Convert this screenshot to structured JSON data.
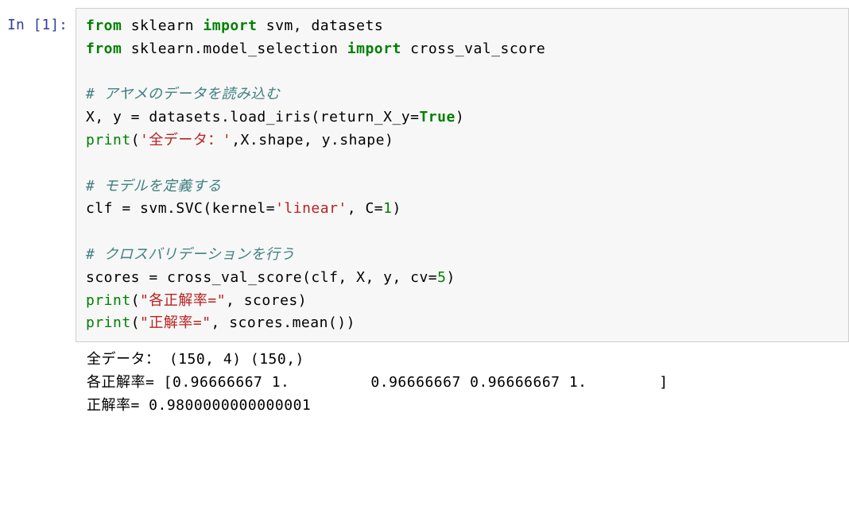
{
  "prompt": "In [1]:",
  "code": {
    "tokens": [
      [
        [
          "from",
          "kw"
        ],
        [
          " sklearn ",
          ""
        ],
        [
          "import",
          "kw"
        ],
        [
          " svm, datasets",
          ""
        ]
      ],
      [
        [
          "from",
          "kw"
        ],
        [
          " sklearn.model_selection ",
          ""
        ],
        [
          "import",
          "kw"
        ],
        [
          " cross_val_score",
          ""
        ]
      ],
      [],
      [
        [
          "# アヤメのデータを読み込む",
          "cm"
        ]
      ],
      [
        [
          "X, y = datasets.load_iris(return_X_y=",
          ""
        ],
        [
          "True",
          "bl"
        ],
        [
          ")",
          ""
        ]
      ],
      [
        [
          "print",
          "fn"
        ],
        [
          "(",
          ""
        ],
        [
          "'全データ：'",
          "st"
        ],
        [
          ",X.shape, y.shape)",
          ""
        ]
      ],
      [],
      [
        [
          "# モデルを定義する",
          "cm"
        ]
      ],
      [
        [
          "clf = svm.SVC(kernel=",
          ""
        ],
        [
          "'linear'",
          "st"
        ],
        [
          ", C=",
          ""
        ],
        [
          "1",
          "nm"
        ],
        [
          ")",
          ""
        ]
      ],
      [],
      [
        [
          "# クロスバリデーションを行う",
          "cm"
        ]
      ],
      [
        [
          "scores = cross_val_score(clf, X, y, cv=",
          ""
        ],
        [
          "5",
          "nm"
        ],
        [
          ")",
          ""
        ]
      ],
      [
        [
          "print",
          "fn"
        ],
        [
          "(",
          ""
        ],
        [
          "\"各正解率=\"",
          "st"
        ],
        [
          ", scores)",
          ""
        ]
      ],
      [
        [
          "print",
          "fn"
        ],
        [
          "(",
          ""
        ],
        [
          "\"正解率=\"",
          "st"
        ],
        [
          ", scores.mean())",
          ""
        ]
      ]
    ]
  },
  "output": {
    "lines": [
      "全データ： (150, 4) (150,)",
      "各正解率= [0.96666667 1.         0.96666667 0.96666667 1.        ]",
      "正解率= 0.9800000000000001"
    ]
  }
}
